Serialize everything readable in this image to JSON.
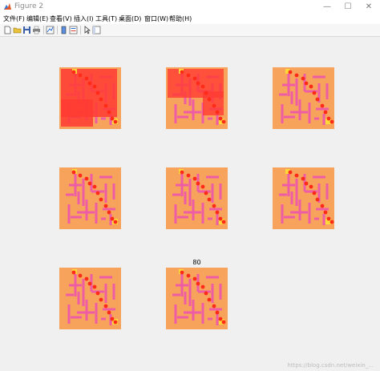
{
  "window": {
    "title": "Figure 2",
    "controls": [
      "—",
      "☐",
      "✕"
    ]
  },
  "menu": {
    "items": [
      "文件(F)",
      "编辑(E)",
      "查看(V)",
      "插入(I)",
      "工具(T)",
      "桌面(D)",
      "窗口(W)",
      "帮助(H)"
    ]
  },
  "toolbar": {
    "icons": [
      "new-figure-icon",
      "open-file-icon",
      "save-icon",
      "print-icon",
      "link-plot-icon",
      "insert-colorbar-icon",
      "insert-legend-icon",
      "edit-plot-cursor-icon",
      "property-inspector-icon"
    ]
  },
  "colors": {
    "maze_floor": "#f7a35c",
    "maze_wall": "#ee5ca6",
    "path_dot": "#ff2a17",
    "visited_fill": "#ff3b33",
    "start_mark": "#ffd83a"
  },
  "figure": {
    "subplots": [
      {
        "title": "",
        "explored": "heavy"
      },
      {
        "title": "",
        "explored": "medium"
      },
      {
        "title": "",
        "explored": "path-only"
      },
      {
        "title": "",
        "explored": "path-only"
      },
      {
        "title": "",
        "explored": "path-only"
      },
      {
        "title": "",
        "explored": "path-only"
      },
      {
        "title": "",
        "explored": "path-only"
      },
      {
        "title": "80",
        "explored": "path-only"
      }
    ]
  },
  "watermark": "https://blog.csdn.net/weixin_..."
}
